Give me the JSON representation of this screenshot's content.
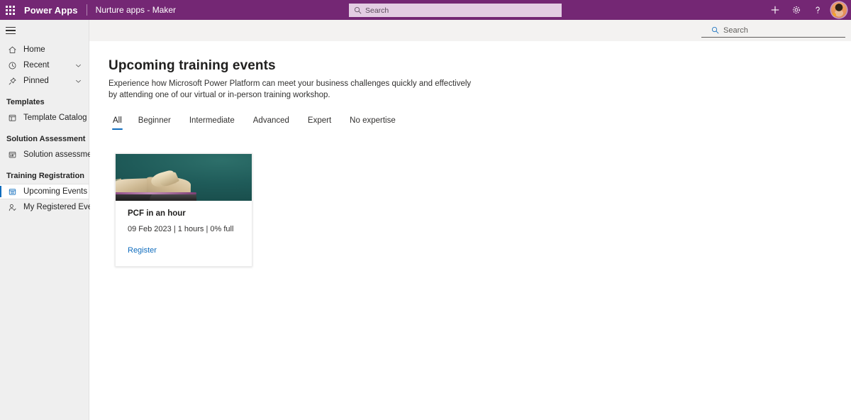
{
  "header": {
    "waffle_label": "App launcher",
    "brand": "Power Apps",
    "app_name": "Nurture apps - Maker",
    "search_placeholder": "Search",
    "icons": {
      "add": "plus-icon",
      "settings": "gear-icon",
      "help": "question-mark-icon",
      "account": "avatar"
    },
    "background_color": "#742774"
  },
  "command_bar": {
    "search_placeholder": "Search"
  },
  "sidebar": {
    "menu_toggle_label": "Menu",
    "items": [
      {
        "label": "Home",
        "icon": "home-icon",
        "expandable": false,
        "selected": false
      },
      {
        "label": "Recent",
        "icon": "clock-icon",
        "expandable": true,
        "selected": false
      },
      {
        "label": "Pinned",
        "icon": "pin-icon",
        "expandable": true,
        "selected": false
      }
    ],
    "groups": [
      {
        "title": "Templates",
        "items": [
          {
            "label": "Template Catalog",
            "icon": "template-catalog-icon",
            "selected": false
          }
        ]
      },
      {
        "title": "Solution Assessment",
        "items": [
          {
            "label": "Solution assessment",
            "icon": "solution-assessment-icon",
            "selected": false
          }
        ]
      },
      {
        "title": "Training Registration",
        "items": [
          {
            "label": "Upcoming Events",
            "icon": "calendar-events-icon",
            "selected": true
          },
          {
            "label": "My Registered Events",
            "icon": "person-check-icon",
            "selected": false
          }
        ]
      }
    ],
    "selection_accent_color": "#0f6cbd"
  },
  "main": {
    "title": "Upcoming training events",
    "description": "Experience how Microsoft Power Platform can meet your business challenges quickly and effectively by attending one of our virtual or in-person training workshop.",
    "tabs": [
      {
        "label": "All",
        "active": true
      },
      {
        "label": "Beginner",
        "active": false
      },
      {
        "label": "Intermediate",
        "active": false
      },
      {
        "label": "Advanced",
        "active": false
      },
      {
        "label": "Expert",
        "active": false
      },
      {
        "label": "No expertise",
        "active": false
      }
    ],
    "tab_accent_color": "#0f6cbd",
    "cards": [
      {
        "image": "open-book-on-teal-background",
        "title": "PCF in an hour",
        "meta": "09 Feb 2023 | 1 hours | 0% full",
        "link_label": "Register"
      }
    ]
  }
}
